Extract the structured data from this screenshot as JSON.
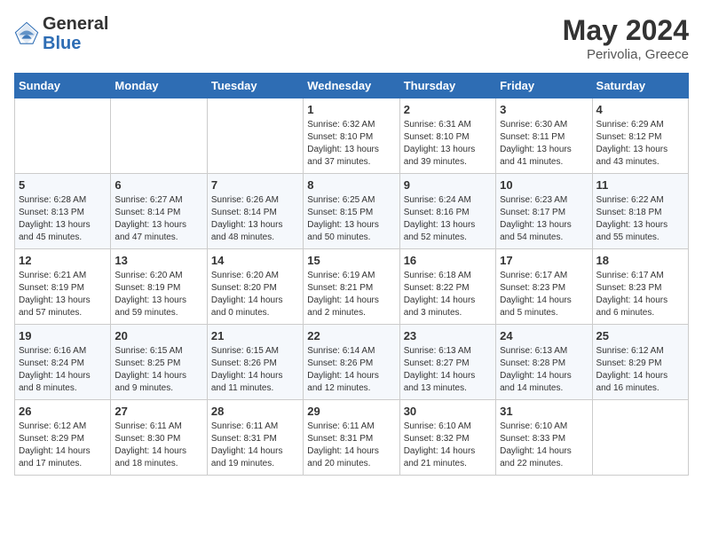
{
  "header": {
    "logo_general": "General",
    "logo_blue": "Blue",
    "month_year": "May 2024",
    "location": "Perivolia, Greece"
  },
  "days_of_week": [
    "Sunday",
    "Monday",
    "Tuesday",
    "Wednesday",
    "Thursday",
    "Friday",
    "Saturday"
  ],
  "weeks": [
    [
      {
        "day": "",
        "info": ""
      },
      {
        "day": "",
        "info": ""
      },
      {
        "day": "",
        "info": ""
      },
      {
        "day": "1",
        "info": "Sunrise: 6:32 AM\nSunset: 8:10 PM\nDaylight: 13 hours\nand 37 minutes."
      },
      {
        "day": "2",
        "info": "Sunrise: 6:31 AM\nSunset: 8:10 PM\nDaylight: 13 hours\nand 39 minutes."
      },
      {
        "day": "3",
        "info": "Sunrise: 6:30 AM\nSunset: 8:11 PM\nDaylight: 13 hours\nand 41 minutes."
      },
      {
        "day": "4",
        "info": "Sunrise: 6:29 AM\nSunset: 8:12 PM\nDaylight: 13 hours\nand 43 minutes."
      }
    ],
    [
      {
        "day": "5",
        "info": "Sunrise: 6:28 AM\nSunset: 8:13 PM\nDaylight: 13 hours\nand 45 minutes."
      },
      {
        "day": "6",
        "info": "Sunrise: 6:27 AM\nSunset: 8:14 PM\nDaylight: 13 hours\nand 47 minutes."
      },
      {
        "day": "7",
        "info": "Sunrise: 6:26 AM\nSunset: 8:14 PM\nDaylight: 13 hours\nand 48 minutes."
      },
      {
        "day": "8",
        "info": "Sunrise: 6:25 AM\nSunset: 8:15 PM\nDaylight: 13 hours\nand 50 minutes."
      },
      {
        "day": "9",
        "info": "Sunrise: 6:24 AM\nSunset: 8:16 PM\nDaylight: 13 hours\nand 52 minutes."
      },
      {
        "day": "10",
        "info": "Sunrise: 6:23 AM\nSunset: 8:17 PM\nDaylight: 13 hours\nand 54 minutes."
      },
      {
        "day": "11",
        "info": "Sunrise: 6:22 AM\nSunset: 8:18 PM\nDaylight: 13 hours\nand 55 minutes."
      }
    ],
    [
      {
        "day": "12",
        "info": "Sunrise: 6:21 AM\nSunset: 8:19 PM\nDaylight: 13 hours\nand 57 minutes."
      },
      {
        "day": "13",
        "info": "Sunrise: 6:20 AM\nSunset: 8:19 PM\nDaylight: 13 hours\nand 59 minutes."
      },
      {
        "day": "14",
        "info": "Sunrise: 6:20 AM\nSunset: 8:20 PM\nDaylight: 14 hours\nand 0 minutes."
      },
      {
        "day": "15",
        "info": "Sunrise: 6:19 AM\nSunset: 8:21 PM\nDaylight: 14 hours\nand 2 minutes."
      },
      {
        "day": "16",
        "info": "Sunrise: 6:18 AM\nSunset: 8:22 PM\nDaylight: 14 hours\nand 3 minutes."
      },
      {
        "day": "17",
        "info": "Sunrise: 6:17 AM\nSunset: 8:23 PM\nDaylight: 14 hours\nand 5 minutes."
      },
      {
        "day": "18",
        "info": "Sunrise: 6:17 AM\nSunset: 8:23 PM\nDaylight: 14 hours\nand 6 minutes."
      }
    ],
    [
      {
        "day": "19",
        "info": "Sunrise: 6:16 AM\nSunset: 8:24 PM\nDaylight: 14 hours\nand 8 minutes."
      },
      {
        "day": "20",
        "info": "Sunrise: 6:15 AM\nSunset: 8:25 PM\nDaylight: 14 hours\nand 9 minutes."
      },
      {
        "day": "21",
        "info": "Sunrise: 6:15 AM\nSunset: 8:26 PM\nDaylight: 14 hours\nand 11 minutes."
      },
      {
        "day": "22",
        "info": "Sunrise: 6:14 AM\nSunset: 8:26 PM\nDaylight: 14 hours\nand 12 minutes."
      },
      {
        "day": "23",
        "info": "Sunrise: 6:13 AM\nSunset: 8:27 PM\nDaylight: 14 hours\nand 13 minutes."
      },
      {
        "day": "24",
        "info": "Sunrise: 6:13 AM\nSunset: 8:28 PM\nDaylight: 14 hours\nand 14 minutes."
      },
      {
        "day": "25",
        "info": "Sunrise: 6:12 AM\nSunset: 8:29 PM\nDaylight: 14 hours\nand 16 minutes."
      }
    ],
    [
      {
        "day": "26",
        "info": "Sunrise: 6:12 AM\nSunset: 8:29 PM\nDaylight: 14 hours\nand 17 minutes."
      },
      {
        "day": "27",
        "info": "Sunrise: 6:11 AM\nSunset: 8:30 PM\nDaylight: 14 hours\nand 18 minutes."
      },
      {
        "day": "28",
        "info": "Sunrise: 6:11 AM\nSunset: 8:31 PM\nDaylight: 14 hours\nand 19 minutes."
      },
      {
        "day": "29",
        "info": "Sunrise: 6:11 AM\nSunset: 8:31 PM\nDaylight: 14 hours\nand 20 minutes."
      },
      {
        "day": "30",
        "info": "Sunrise: 6:10 AM\nSunset: 8:32 PM\nDaylight: 14 hours\nand 21 minutes."
      },
      {
        "day": "31",
        "info": "Sunrise: 6:10 AM\nSunset: 8:33 PM\nDaylight: 14 hours\nand 22 minutes."
      },
      {
        "day": "",
        "info": ""
      }
    ]
  ]
}
